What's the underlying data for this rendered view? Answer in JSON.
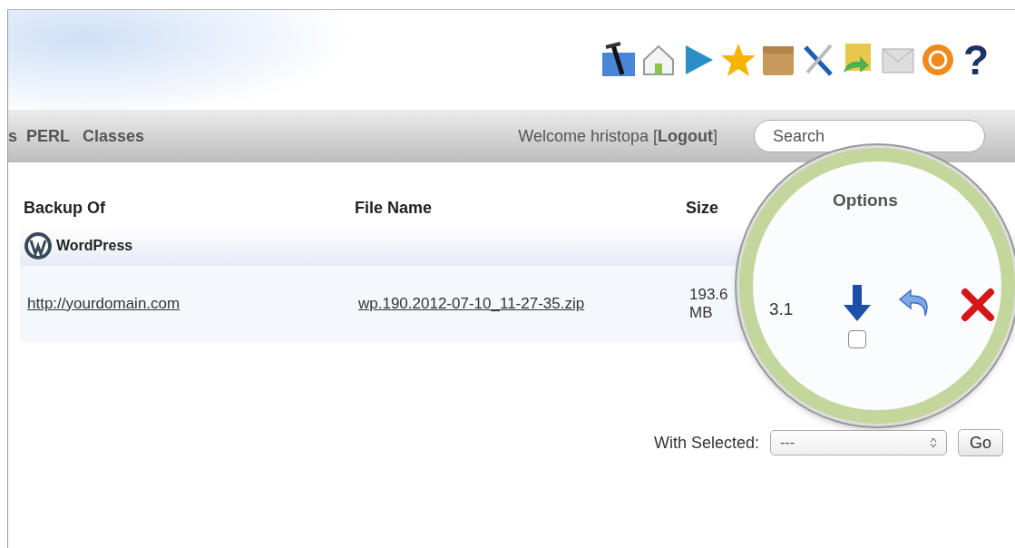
{
  "toolbar": {
    "help": "?"
  },
  "nav": {
    "items": [
      "s",
      "PERL",
      "Classes"
    ],
    "welcome": "Welcome hristopa [**Logout**]",
    "search": {
      "placeholder": "Search"
    }
  },
  "table": {
    "columns": [
      "Backup Of",
      "File Name",
      "Size"
    ],
    "group": {
      "label": "WordPress"
    },
    "rows": [
      {
        "backup_of": "http://yourdomain.com",
        "file_name": "wp.190.2012-07-10_11-27-35.zip",
        "size": "193.6 MB",
        "column_4": "3.1"
      }
    ]
  },
  "magnifier": {
    "header": "Options",
    "row_checkbox": {
      "checked": false
    }
  },
  "bulk_actions": {
    "label": "With Selected:",
    "value": "---",
    "button": "Go"
  }
}
